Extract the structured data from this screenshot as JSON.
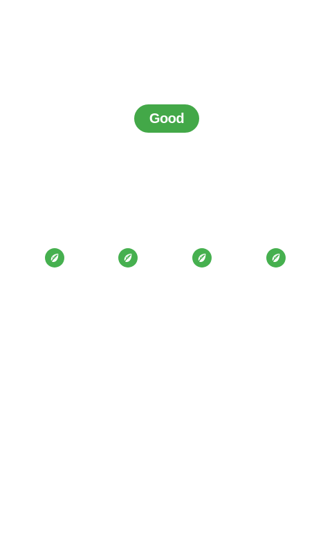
{
  "status": {
    "label": "Good",
    "color": "#43a848"
  },
  "indicators": {
    "icon": "leaf-icon",
    "count": 4,
    "color": "#46b04f"
  }
}
